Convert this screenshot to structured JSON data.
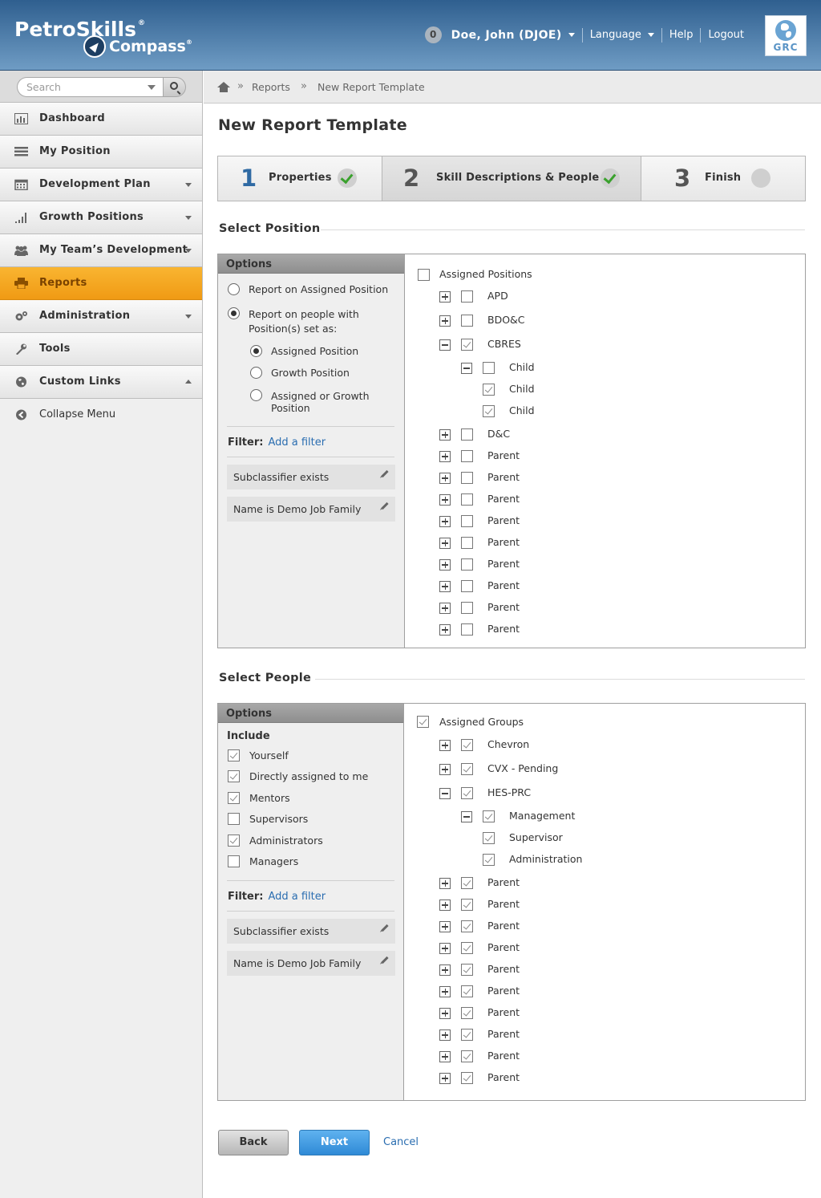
{
  "brand": {
    "name": "PetroSkills",
    "product": "Compass",
    "reg": "®"
  },
  "user": {
    "notification_count": "0",
    "name": "Doe, John (DJOE)"
  },
  "topnav": {
    "language": "Language",
    "help": "Help",
    "logout": "Logout"
  },
  "grc": {
    "label": "GRC"
  },
  "search": {
    "placeholder": "Search"
  },
  "sidebar": {
    "items": [
      {
        "label": "Dashboard",
        "icon": "bar-chart-icon"
      },
      {
        "label": "My Position",
        "icon": "list-icon"
      },
      {
        "label": "Development Plan",
        "icon": "calendar-icon"
      },
      {
        "label": "Growth Positions",
        "icon": "signal-bars-icon"
      },
      {
        "label": "My Team’s Development",
        "icon": "people-icon"
      },
      {
        "label": "Reports",
        "icon": "printer-icon",
        "active": true
      },
      {
        "label": "Administration",
        "icon": "gears-icon"
      },
      {
        "label": "Tools",
        "icon": "wrench-icon"
      },
      {
        "label": "Custom Links",
        "icon": "globe-icon"
      }
    ],
    "collapse": "Collapse Menu"
  },
  "breadcrumb": {
    "sep": "»",
    "items": [
      "Reports",
      "New Report Template"
    ]
  },
  "page": {
    "title": "New Report Template"
  },
  "steps": [
    {
      "num": "1",
      "label": "Properties",
      "status": "done"
    },
    {
      "num": "2",
      "label": "Skill Descriptions & People",
      "status": "done"
    },
    {
      "num": "3",
      "label": "Finish",
      "status": "pending"
    }
  ],
  "select_position": {
    "heading": "Select Position",
    "options_title": "Options",
    "radio1": "Report on Assigned Position",
    "radio2": "Report on people with Position(s) set as:",
    "sub1": "Assigned Position",
    "sub2": "Growth Position",
    "sub3": "Assigned or Growth Position",
    "filter_label": "Filter:",
    "add_filter": "Add a filter",
    "chips": [
      "Subclassifier exists",
      "Name is Demo Job Family"
    ],
    "tree_root": "Assigned Positions",
    "tree": [
      {
        "label": "APD",
        "expander": "plus",
        "checked": false,
        "level": 1
      },
      {
        "label": "BDO&C",
        "expander": "plus",
        "checked": false,
        "level": 1
      },
      {
        "label": "CBRES",
        "expander": "minus",
        "checked": true,
        "level": 1
      },
      {
        "label": "Child",
        "expander": "minus",
        "checked": false,
        "level": 2
      },
      {
        "label": "Child",
        "expander": "",
        "checked": true,
        "level": 2
      },
      {
        "label": "Child",
        "expander": "",
        "checked": true,
        "level": 2
      },
      {
        "label": "D&C",
        "expander": "plus",
        "checked": false,
        "level": 1
      },
      {
        "label": "Parent",
        "expander": "plus",
        "checked": false,
        "level": 1
      },
      {
        "label": "Parent",
        "expander": "plus",
        "checked": false,
        "level": 1
      },
      {
        "label": "Parent",
        "expander": "plus",
        "checked": false,
        "level": 1
      },
      {
        "label": "Parent",
        "expander": "plus",
        "checked": false,
        "level": 1
      },
      {
        "label": "Parent",
        "expander": "plus",
        "checked": false,
        "level": 1
      },
      {
        "label": "Parent",
        "expander": "plus",
        "checked": false,
        "level": 1
      },
      {
        "label": "Parent",
        "expander": "plus",
        "checked": false,
        "level": 1
      },
      {
        "label": "Parent",
        "expander": "plus",
        "checked": false,
        "level": 1
      },
      {
        "label": "Parent",
        "expander": "plus",
        "checked": false,
        "level": 1
      }
    ]
  },
  "select_people": {
    "heading": "Select People",
    "options_title": "Options",
    "include_label": "Include",
    "include": [
      {
        "label": "Yourself",
        "checked": true
      },
      {
        "label": "Directly assigned to me",
        "checked": true
      },
      {
        "label": "Mentors",
        "checked": true
      },
      {
        "label": "Supervisors",
        "checked": false
      },
      {
        "label": "Administrators",
        "checked": true
      },
      {
        "label": "Managers",
        "checked": false
      }
    ],
    "filter_label": "Filter:",
    "add_filter": "Add a filter",
    "chips": [
      "Subclassifier exists",
      "Name is Demo Job Family"
    ],
    "tree_root": "Assigned Groups",
    "tree": [
      {
        "label": "Chevron",
        "expander": "plus",
        "checked": true,
        "level": 1
      },
      {
        "label": "CVX - Pending",
        "expander": "plus",
        "checked": true,
        "level": 1
      },
      {
        "label": "HES-PRC",
        "expander": "minus",
        "checked": true,
        "level": 1
      },
      {
        "label": "Management",
        "expander": "minus",
        "checked": true,
        "level": 2
      },
      {
        "label": "Supervisor",
        "expander": "",
        "checked": true,
        "level": 2
      },
      {
        "label": "Administration",
        "expander": "",
        "checked": true,
        "level": 2
      },
      {
        "label": "Parent",
        "expander": "plus",
        "checked": true,
        "level": 1
      },
      {
        "label": "Parent",
        "expander": "plus",
        "checked": true,
        "level": 1
      },
      {
        "label": "Parent",
        "expander": "plus",
        "checked": true,
        "level": 1
      },
      {
        "label": "Parent",
        "expander": "plus",
        "checked": true,
        "level": 1
      },
      {
        "label": "Parent",
        "expander": "plus",
        "checked": true,
        "level": 1
      },
      {
        "label": "Parent",
        "expander": "plus",
        "checked": true,
        "level": 1
      },
      {
        "label": "Parent",
        "expander": "plus",
        "checked": true,
        "level": 1
      },
      {
        "label": "Parent",
        "expander": "plus",
        "checked": true,
        "level": 1
      },
      {
        "label": "Parent",
        "expander": "plus",
        "checked": true,
        "level": 1
      },
      {
        "label": "Parent",
        "expander": "plus",
        "checked": true,
        "level": 1
      }
    ]
  },
  "footer_buttons": {
    "back": "Back",
    "next": "Next",
    "cancel": "Cancel"
  },
  "colors": {
    "header_top": "#2f5f8f",
    "header_bottom": "#6f9cc4",
    "active_nav": "#f5a623",
    "link": "#2a6db0",
    "primary_button": "#3b93dc",
    "step_number": "#2f6aa3",
    "check_green": "#3aa12d"
  }
}
